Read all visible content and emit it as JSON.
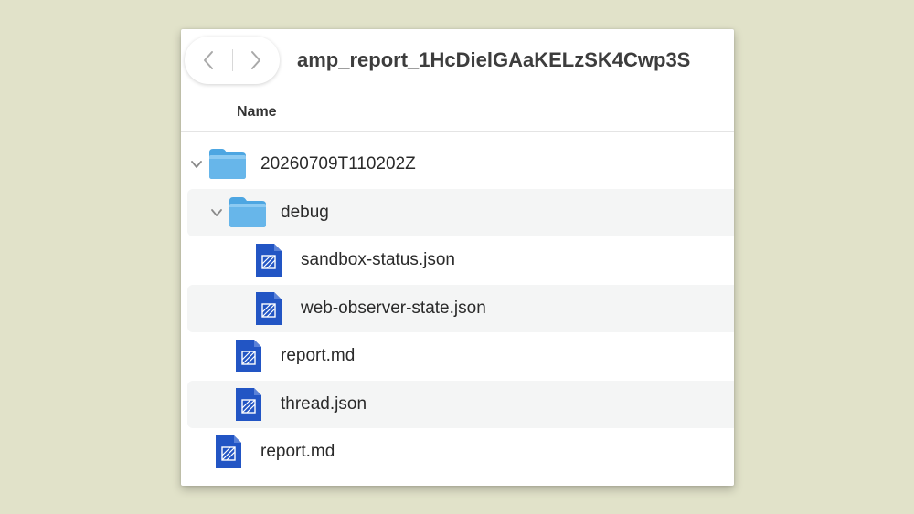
{
  "window": {
    "title": "amp_report_1HcDielGAaKELzSK4Cwp3S"
  },
  "nav": {
    "back_icon": "chevron-left-icon",
    "forward_icon": "chevron-right-icon"
  },
  "header": {
    "name_column": "Name"
  },
  "tree": [
    {
      "name": "20260709T110202Z",
      "kind": "folder",
      "depth": 0,
      "expanded": true
    },
    {
      "name": "debug",
      "kind": "folder",
      "depth": 1,
      "expanded": true
    },
    {
      "name": "sandbox-status.json",
      "kind": "file",
      "depth": 2
    },
    {
      "name": "web-observer-state.json",
      "kind": "file",
      "depth": 2
    },
    {
      "name": "report.md",
      "kind": "file",
      "depth": 1
    },
    {
      "name": "thread.json",
      "kind": "file",
      "depth": 1
    },
    {
      "name": "report.md",
      "kind": "file",
      "depth": 0
    }
  ],
  "colors": {
    "background": "#e1e2c9",
    "folder_blue": "#67b6ea",
    "file_blue": "#2255c4",
    "row_stripe": "#f4f5f5"
  }
}
